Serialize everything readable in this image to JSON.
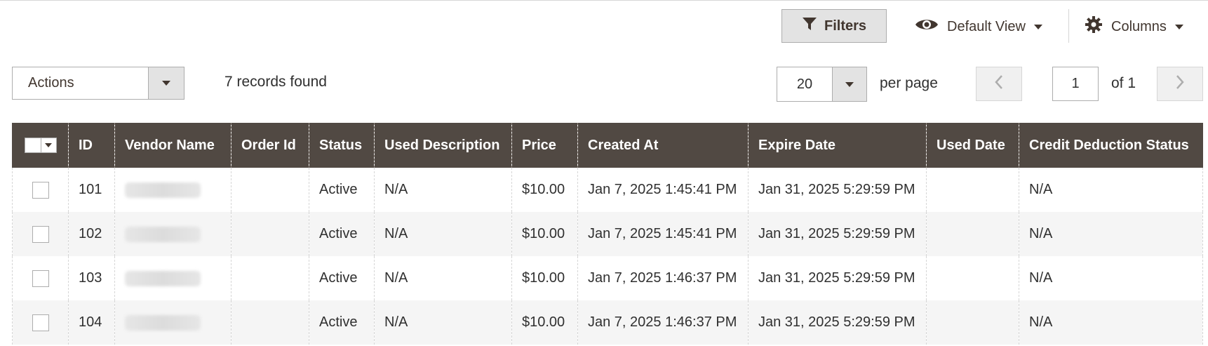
{
  "toolbar": {
    "filters_label": "Filters",
    "view_label": "Default View",
    "columns_label": "Columns"
  },
  "actions": {
    "label": "Actions"
  },
  "records_found": "7 records found",
  "pagination": {
    "per_page_value": "20",
    "per_page_label": "per page",
    "current_page": "1",
    "of_label": "of 1"
  },
  "table": {
    "headers": {
      "id": "ID",
      "vendor": "Vendor Name",
      "order": "Order Id",
      "status": "Status",
      "used_desc": "Used Description",
      "price": "Price",
      "created": "Created At",
      "expire": "Expire Date",
      "used_date": "Used Date",
      "credit": "Credit Deduction Status"
    },
    "rows": [
      {
        "id": "101",
        "order": "",
        "status": "Active",
        "used_desc": "N/A",
        "price": "$10.00",
        "created": "Jan 7, 2025 1:45:41 PM",
        "expire": "Jan 31, 2025 5:29:59 PM",
        "used_date": "",
        "credit": "N/A"
      },
      {
        "id": "102",
        "order": "",
        "status": "Active",
        "used_desc": "N/A",
        "price": "$10.00",
        "created": "Jan 7, 2025 1:45:41 PM",
        "expire": "Jan 31, 2025 5:29:59 PM",
        "used_date": "",
        "credit": "N/A"
      },
      {
        "id": "103",
        "order": "",
        "status": "Active",
        "used_desc": "N/A",
        "price": "$10.00",
        "created": "Jan 7, 2025 1:46:37 PM",
        "expire": "Jan 31, 2025 5:29:59 PM",
        "used_date": "",
        "credit": "N/A"
      },
      {
        "id": "104",
        "order": "",
        "status": "Active",
        "used_desc": "N/A",
        "price": "$10.00",
        "created": "Jan 7, 2025 1:46:37 PM",
        "expire": "Jan 31, 2025 5:29:59 PM",
        "used_date": "",
        "credit": "N/A"
      }
    ]
  },
  "colors": {
    "header_bg": "#514943",
    "button_bg": "#e3e3e3",
    "text": "#303030",
    "row_alt": "#f5f5f5"
  }
}
